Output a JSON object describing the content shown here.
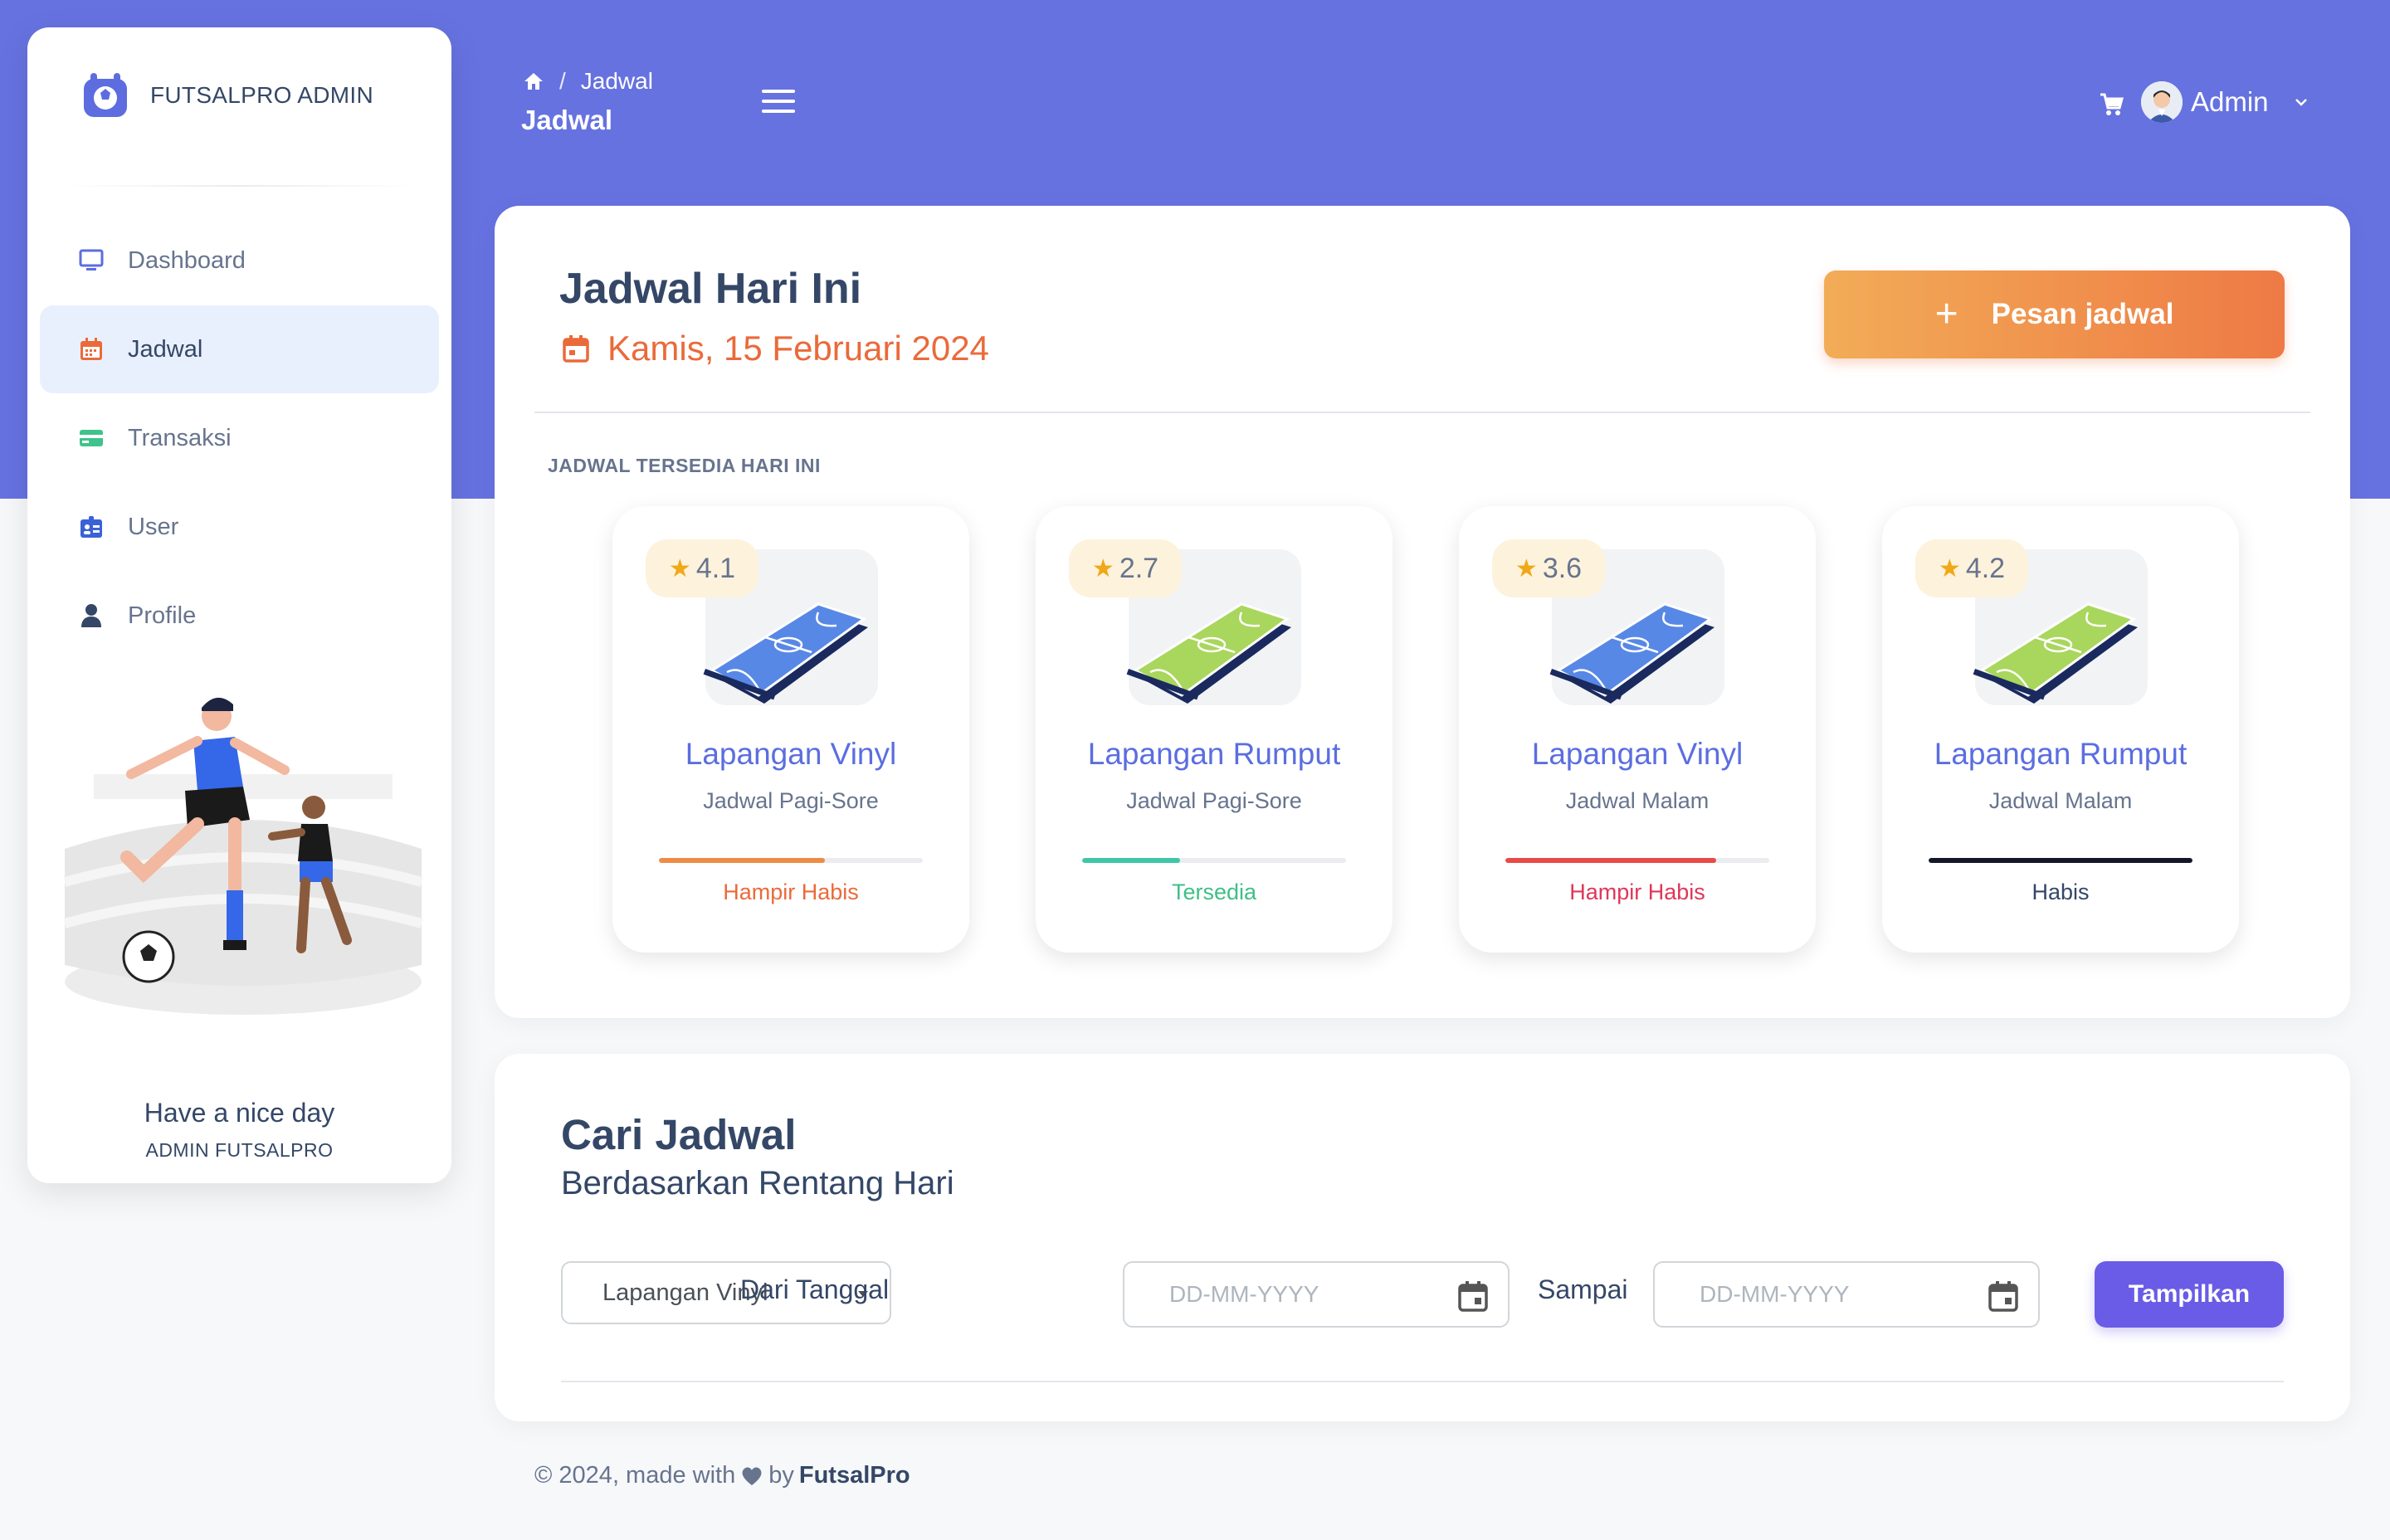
{
  "brand": {
    "name": "FUTSALPRO ADMIN",
    "icon": "futsal-logo-icon"
  },
  "sidebar": {
    "items": [
      {
        "label": "Dashboard",
        "icon": "monitor-icon",
        "active": false
      },
      {
        "label": "Jadwal",
        "icon": "calendar-icon",
        "active": true
      },
      {
        "label": "Transaksi",
        "icon": "credit-card-icon",
        "active": false
      },
      {
        "label": "User",
        "icon": "id-badge-icon",
        "active": false
      },
      {
        "label": "Profile",
        "icon": "person-icon",
        "active": false
      }
    ],
    "greeting": "Have a nice day",
    "greeting_sub": "ADMIN FUTSALPRO"
  },
  "header": {
    "breadcrumb": {
      "sep": "/",
      "current": "Jadwal"
    },
    "title": "Jadwal",
    "user_name": "Admin"
  },
  "today": {
    "title": "Jadwal Hari Ini",
    "date": "Kamis, 15 Februari 2024",
    "book_button": "Pesan jadwal",
    "section_label": "JADWAL TERSEDIA HARI INI",
    "courts": [
      {
        "rating": "4.1",
        "name": "Lapangan Vinyl",
        "schedule": "Jadwal Pagi-Sore",
        "status": "Hampir Habis",
        "status_color": "#ea6a3a",
        "fill": 0.63,
        "fill_color": "#ee8c46",
        "field_color": "#5888e6"
      },
      {
        "rating": "2.7",
        "name": "Lapangan Rumput",
        "schedule": "Jadwal Pagi-Sore",
        "status": "Tersedia",
        "status_color": "#3fbf87",
        "fill": 0.37,
        "fill_color": "#3fc6a8",
        "field_color": "#a9d65c"
      },
      {
        "rating": "3.6",
        "name": "Lapangan Vinyl",
        "schedule": "Jadwal Malam",
        "status": "Hampir Habis",
        "status_color": "#e0365a",
        "fill": 0.8,
        "fill_color": "#e94a47",
        "field_color": "#5888e6"
      },
      {
        "rating": "4.2",
        "name": "Lapangan Rumput",
        "schedule": "Jadwal Malam",
        "status": "Habis",
        "status_color": "#344767",
        "fill": 1.0,
        "fill_color": "#141727",
        "field_color": "#a9d65c"
      }
    ]
  },
  "search": {
    "title": "Cari Jadwal",
    "subtitle": "Berdasarkan Rentang Hari",
    "court_select": "Lapangan Vinyl",
    "from_label": "Dari Tanggal",
    "from_placeholder": "DD-MM-YYYY",
    "to_label": "Sampai",
    "to_placeholder": "DD-MM-YYYY",
    "submit": "Tampilkan"
  },
  "footer": {
    "prefix": "© 2024, made with",
    "by": "by",
    "brand": "FutsalPro"
  },
  "colors": {
    "primary": "#6672e0",
    "accent": "#ee7a45",
    "submit": "#6a5ce6"
  }
}
